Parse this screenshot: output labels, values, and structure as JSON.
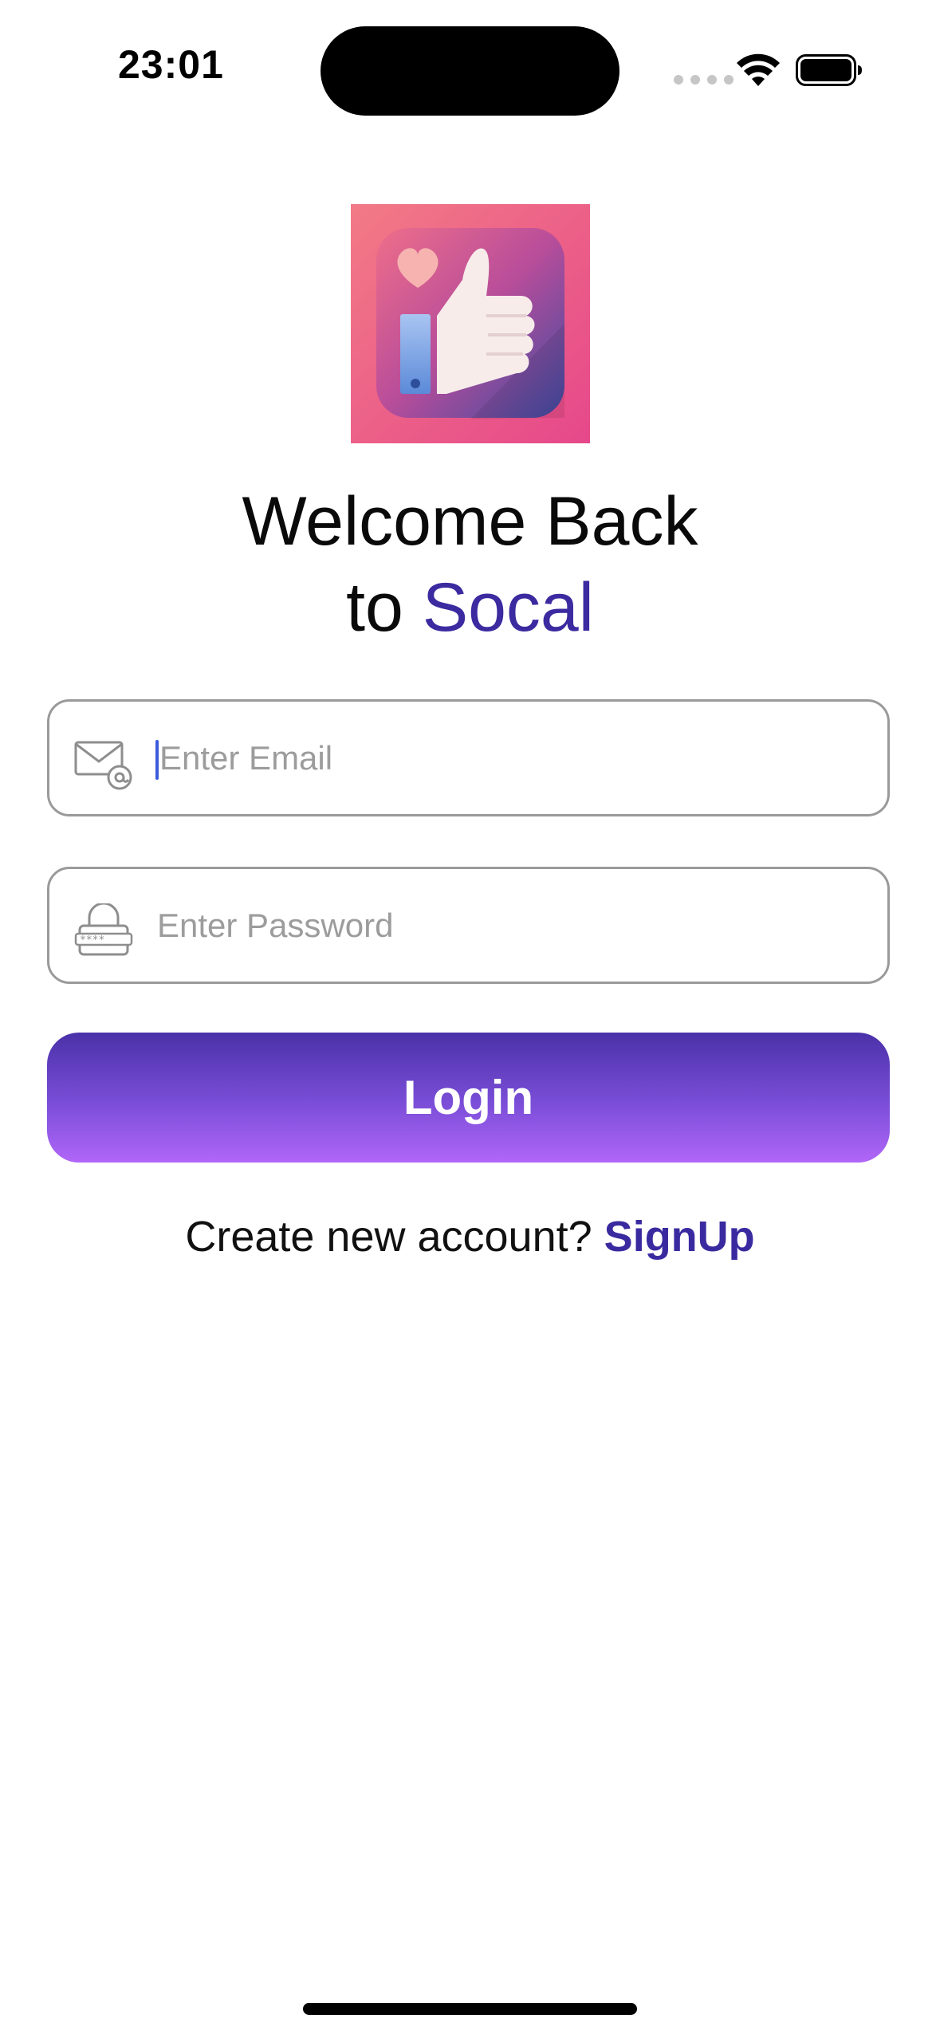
{
  "status_bar": {
    "time": "23:01",
    "icons": [
      "cellular-signal-icon",
      "wifi-icon",
      "battery-icon"
    ]
  },
  "app": {
    "icon": "thumbs-up-heart-app-icon"
  },
  "heading": {
    "line1": "Welcome Back",
    "line2_prefix": "to ",
    "brand": "Socal",
    "brand_color": "#3b2aa0"
  },
  "form": {
    "email": {
      "icon": "envelope-at-icon",
      "placeholder": "Enter Email",
      "value": ""
    },
    "password": {
      "icon": "padlock-password-icon",
      "placeholder": "Enter Password",
      "value": ""
    },
    "login_label": "Login",
    "login_gradient": [
      "#4a31a8",
      "#b166f8"
    ]
  },
  "signup": {
    "prompt": "Create new account? ",
    "link_label": "SignUp",
    "link_color": "#3a2aa0"
  }
}
